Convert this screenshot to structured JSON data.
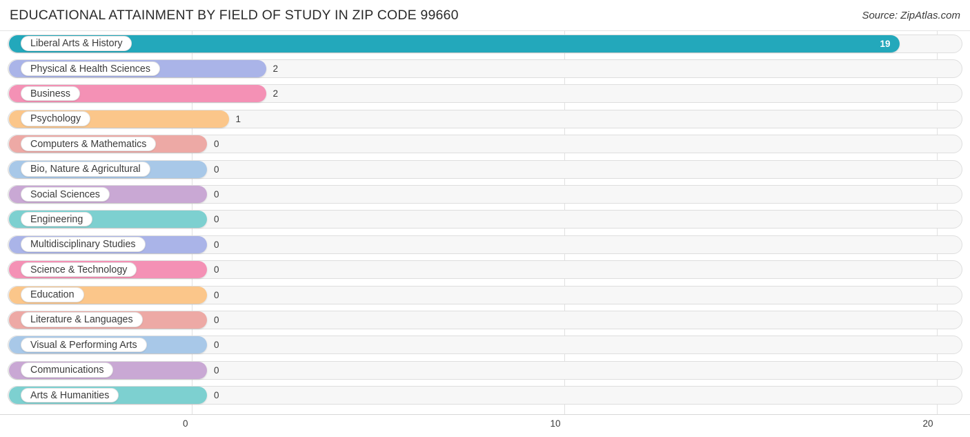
{
  "header": {
    "title": "EDUCATIONAL ATTAINMENT BY FIELD OF STUDY IN ZIP CODE 99660",
    "source": "Source: ZipAtlas.com"
  },
  "axis": {
    "ticks": [
      {
        "label": "0",
        "value": 0
      },
      {
        "label": "10",
        "value": 10
      },
      {
        "label": "20",
        "value": 20
      }
    ]
  },
  "chart_data": {
    "type": "bar",
    "orientation": "horizontal",
    "title": "EDUCATIONAL ATTAINMENT BY FIELD OF STUDY IN ZIP CODE 99660",
    "subtitle": "",
    "xlabel": "",
    "ylabel": "",
    "xlim": [
      0,
      20
    ],
    "xticks": [
      0,
      10,
      20
    ],
    "grid": true,
    "legend": false,
    "source": "Source: ZipAtlas.com",
    "categories": [
      "Liberal Arts & History",
      "Physical & Health Sciences",
      "Business",
      "Psychology",
      "Computers & Mathematics",
      "Bio, Nature & Agricultural",
      "Social Sciences",
      "Engineering",
      "Multidisciplinary Studies",
      "Science & Technology",
      "Education",
      "Literature & Languages",
      "Visual & Performing Arts",
      "Communications",
      "Arts & Humanities"
    ],
    "values": [
      19,
      2,
      2,
      1,
      0,
      0,
      0,
      0,
      0,
      0,
      0,
      0,
      0,
      0,
      0
    ],
    "value_labels": [
      "19",
      "2",
      "2",
      "1",
      "0",
      "0",
      "0",
      "0",
      "0",
      "0",
      "0",
      "0",
      "0",
      "0",
      "0"
    ],
    "colors": [
      "#23a8bb",
      "#aab4e8",
      "#f491b5",
      "#fbc68a",
      "#eda9a5",
      "#a8c8e8",
      "#c9a8d4",
      "#7dd0d0",
      "#aab4e8",
      "#f491b5",
      "#fbc68a",
      "#eda9a5",
      "#a8c8e8",
      "#c9a8d4",
      "#7dd0d0"
    ]
  }
}
